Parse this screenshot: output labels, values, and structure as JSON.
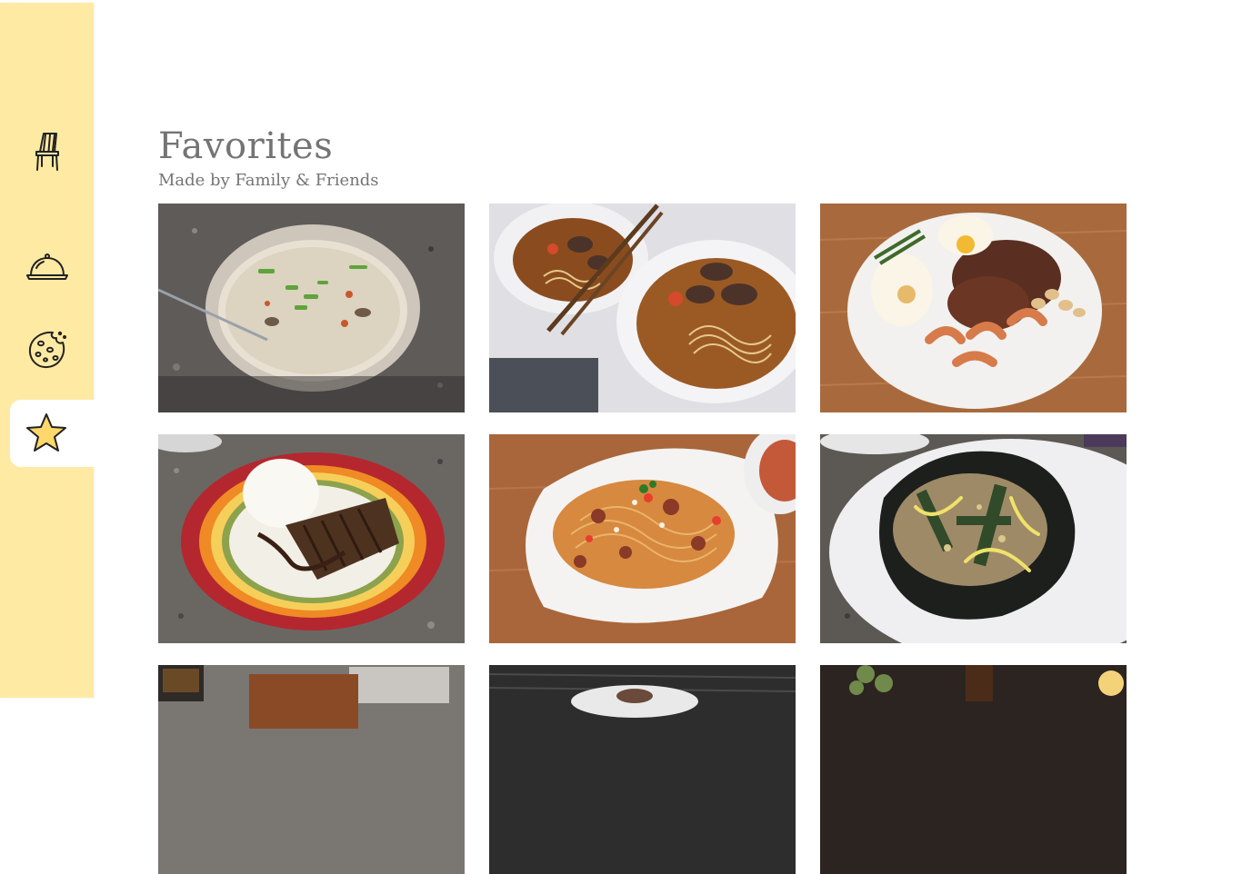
{
  "page": {
    "title": "Favorites",
    "subtitle": "Made by Family & Friends"
  },
  "sidebar": {
    "items": [
      {
        "icon": "chair-icon",
        "name": "sidebar-item-chair"
      },
      {
        "icon": "cloche-icon",
        "name": "sidebar-item-dishes"
      },
      {
        "icon": "cookie-icon",
        "name": "sidebar-item-desserts"
      },
      {
        "icon": "star-icon",
        "name": "sidebar-item-favorites",
        "active": true
      }
    ],
    "colors": {
      "background": "#ffeaa3",
      "active": "#ffffff",
      "star": "#ffd86b"
    }
  },
  "photos": [
    {
      "name": "photo-congee",
      "dish": "congee"
    },
    {
      "name": "photo-beef-noodle-soup",
      "dish": "beef noodle soup"
    },
    {
      "name": "photo-steak-eggs-shrimp",
      "dish": "steak, eggs and shrimp"
    },
    {
      "name": "photo-pork-cutlet-rice",
      "dish": "pork cutlet with rice"
    },
    {
      "name": "photo-spaghetti",
      "dish": "spaghetti"
    },
    {
      "name": "photo-seaweed-rice-balls",
      "dish": "seaweed rice balls"
    },
    {
      "name": "photo-row3-1",
      "dish": "partially visible"
    },
    {
      "name": "photo-row3-2",
      "dish": "partially visible"
    },
    {
      "name": "photo-row3-3",
      "dish": "partially visible"
    }
  ]
}
